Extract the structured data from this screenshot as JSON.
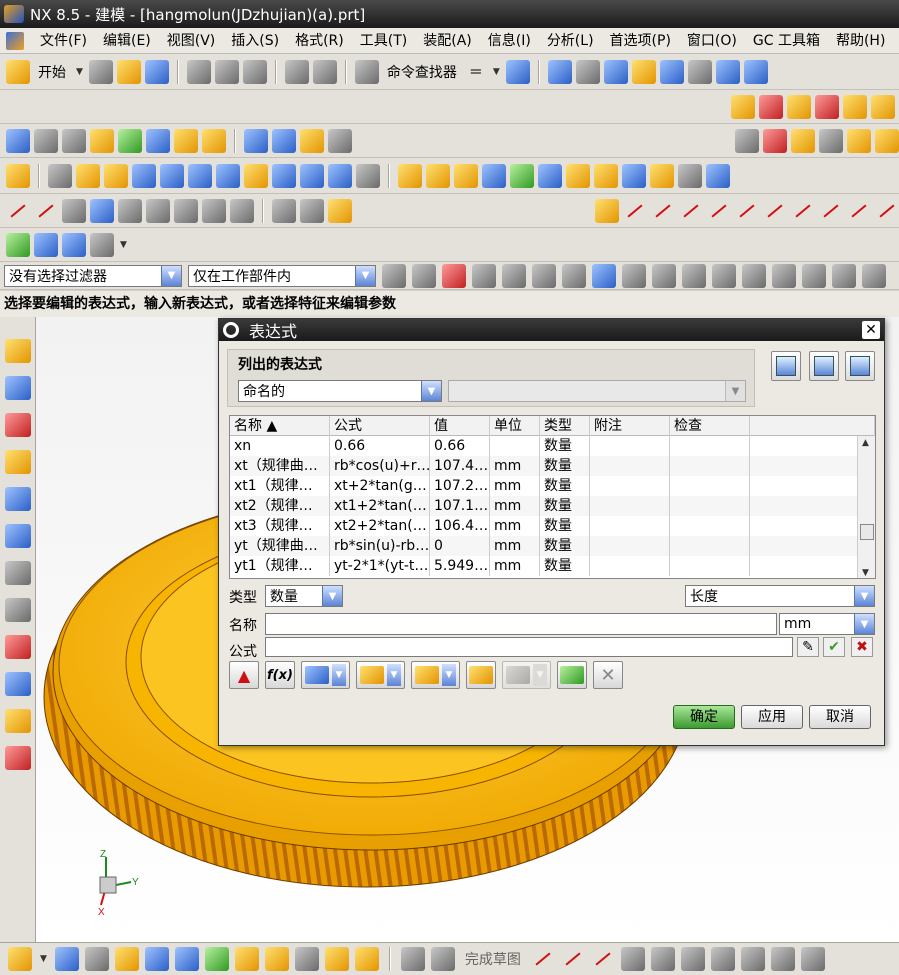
{
  "window": {
    "title": "NX 8.5 - 建模 - [hangmolun(JDzhujian)(a).prt]"
  },
  "menubar": {
    "items": [
      "文件(F)",
      "编辑(E)",
      "视图(V)",
      "插入(S)",
      "格式(R)",
      "工具(T)",
      "装配(A)",
      "信息(I)",
      "分析(L)",
      "首选项(P)",
      "窗口(O)",
      "GC 工具箱",
      "帮助(H)"
    ]
  },
  "toolbar": {
    "start_label": "开始",
    "finder_label": "命令查找器"
  },
  "filter": {
    "selection_filter": "没有选择过滤器",
    "scope": "仅在工作部件内"
  },
  "status": {
    "prompt": "选择要编辑的表达式，输入新表达式，或者选择特征来编辑参数"
  },
  "dialog": {
    "title": "表达式",
    "list_group_title": "列出的表达式",
    "list_type": "命名的",
    "table": {
      "headers": [
        "名称 ▲",
        "公式",
        "值",
        "单位",
        "类型",
        "附注",
        "检查"
      ],
      "rows": [
        [
          "xn",
          "0.66",
          "0.66",
          "",
          "数量",
          "",
          ""
        ],
        [
          "xt（规律曲…",
          "rb*cos(u)+r…",
          "107.4…",
          "mm",
          "数量",
          "",
          ""
        ],
        [
          "xt1（规律…",
          "xt+2*tan(g…",
          "107.2…",
          "mm",
          "数量",
          "",
          ""
        ],
        [
          "xt2（规律…",
          "xt1+2*tan(…",
          "107.1…",
          "mm",
          "数量",
          "",
          ""
        ],
        [
          "xt3（规律…",
          "xt2+2*tan(…",
          "106.4…",
          "mm",
          "数量",
          "",
          ""
        ],
        [
          "yt（规律曲…",
          "rb*sin(u)-rb…",
          "0",
          "mm",
          "数量",
          "",
          ""
        ],
        [
          "yt1（规律…",
          "yt-2*1*(yt-t…",
          "5.949…",
          "mm",
          "数量",
          "",
          ""
        ]
      ]
    },
    "type_label": "类型",
    "type_value": "数量",
    "unit_category": "长度",
    "name_label": "名称",
    "name_value": "",
    "unit_value": "mm",
    "formula_label": "公式",
    "formula_value": "",
    "ok_label": "确定",
    "apply_label": "应用",
    "cancel_label": "取消"
  },
  "bottombar": {
    "sketch_label": "完成草图"
  },
  "colors": {
    "gear": "#f5b800",
    "accent_ok": "#3c9a2e"
  }
}
